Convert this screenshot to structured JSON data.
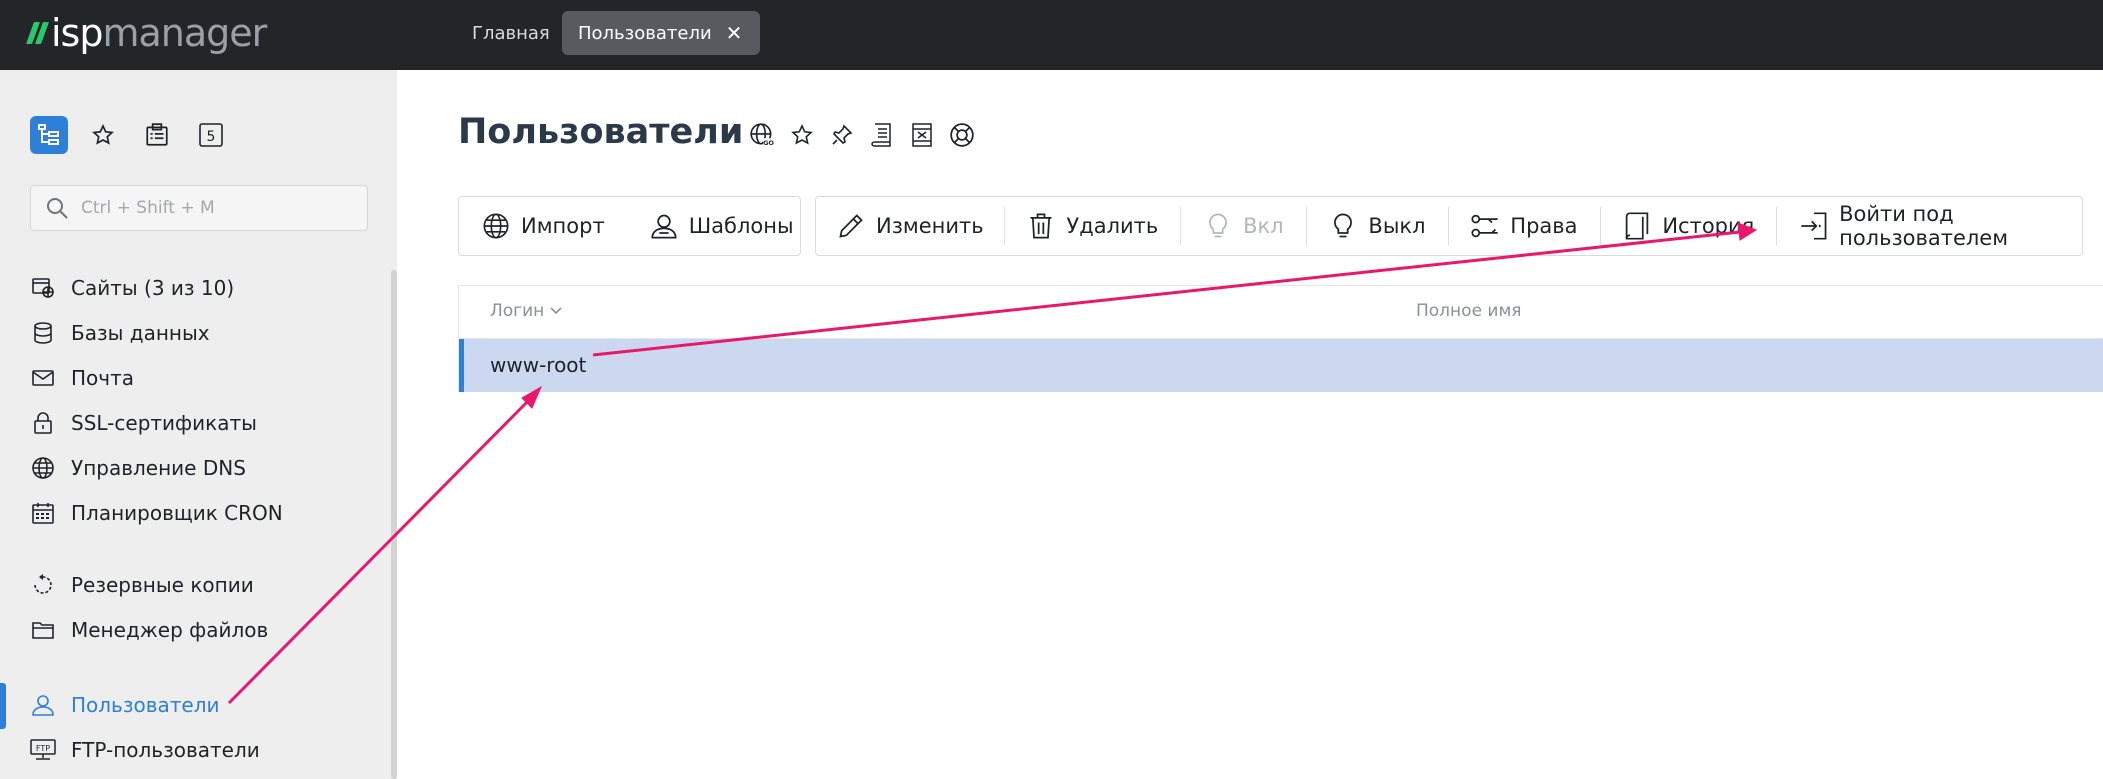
{
  "app": {
    "logo_prefix": "isp",
    "logo_suffix": "manager"
  },
  "tabs": [
    {
      "label": "Главная",
      "active": false
    },
    {
      "label": "Пользователи",
      "active": true
    }
  ],
  "sidebar": {
    "quick_icons": [
      "tree-icon",
      "star-icon",
      "clipboard-icon",
      "5"
    ],
    "search_placeholder": "Ctrl + Shift + M",
    "items": [
      {
        "label": "Сайты (3 из 10)",
        "icon": "sites-icon"
      },
      {
        "label": "Базы данных",
        "icon": "database-icon"
      },
      {
        "label": "Почта",
        "icon": "mail-icon"
      },
      {
        "label": "SSL-сертификаты",
        "icon": "lock-icon"
      },
      {
        "label": "Управление DNS",
        "icon": "globe-icon"
      },
      {
        "label": "Планировщик CRON",
        "icon": "calendar-icon"
      },
      {
        "label": "Резервные копии",
        "icon": "backup-icon"
      },
      {
        "label": "Менеджер файлов",
        "icon": "folder-icon"
      },
      {
        "label": "Пользователи",
        "icon": "user-icon",
        "active": true
      },
      {
        "label": "FTP-пользователи",
        "icon": "ftp-icon"
      }
    ]
  },
  "main": {
    "title": "Пользователи",
    "title_icons": [
      "web-icon",
      "star-icon",
      "pin-icon",
      "list-icon",
      "excel-icon",
      "help-icon"
    ],
    "toolbar_left": [
      {
        "label": "Импорт",
        "icon": "globe-icon"
      },
      {
        "label": "Шаблоны",
        "icon": "user-template-icon"
      }
    ],
    "toolbar_right": [
      {
        "label": "Изменить",
        "icon": "pencil-icon",
        "disabled": false
      },
      {
        "label": "Удалить",
        "icon": "trash-icon",
        "disabled": false
      },
      {
        "label": "Вкл",
        "icon": "bulb-icon",
        "disabled": true
      },
      {
        "label": "Выкл",
        "icon": "bulb-off-icon",
        "disabled": false
      },
      {
        "label": "Права",
        "icon": "permissions-icon",
        "disabled": false
      },
      {
        "label": "История",
        "icon": "history-icon",
        "disabled": false
      },
      {
        "label": "Войти под пользователем",
        "icon": "login-icon",
        "disabled": false
      }
    ],
    "table": {
      "columns": [
        "Логин",
        "Полное имя"
      ],
      "rows": [
        {
          "login": "www-root",
          "full_name": "",
          "selected": true
        }
      ]
    }
  },
  "colors": {
    "topbar": "#232629",
    "accent": "#2e7fd8",
    "logo_green": "#2ec66b",
    "sidebar_bg": "#eeeeee",
    "selected_row": "#cbd8ef",
    "annotation_arrow": "#e8186c"
  }
}
